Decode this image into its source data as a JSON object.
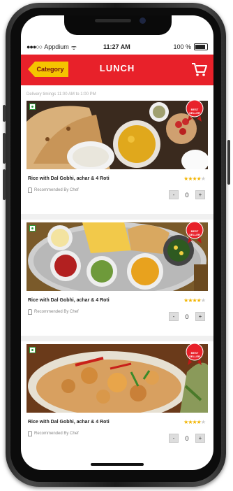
{
  "status_bar": {
    "carrier": "Appdium",
    "time": "11:27 AM",
    "battery": "100 %"
  },
  "header": {
    "back_label": "Category",
    "title": "LUNCH"
  },
  "delivery_note": "Delivery timings 11:00 AM to 1:00 PM",
  "items": [
    {
      "name": "Rice with Dal Gobhi, achar & 4 Roti",
      "recommended": "Recommended By Chef",
      "rating": 4,
      "quantity": "0",
      "badge": "BEST SELLER"
    },
    {
      "name": "Rice with Dal Gobhi, achar & 4 Roti",
      "recommended": "Recommended By Chef",
      "rating": 4,
      "quantity": "0",
      "badge": "BEST SELLER"
    },
    {
      "name": "Rice with Dal Gobhi, achar & 4 Roti",
      "recommended": "Recommended By Chef",
      "rating": 4,
      "quantity": "0",
      "badge": "BEST SELLER"
    }
  ],
  "stepper": {
    "minus": "-",
    "plus": "+"
  },
  "colors": {
    "header_red": "#e8212a",
    "category_yellow": "#f5c400",
    "star_gold": "#f2b400"
  }
}
